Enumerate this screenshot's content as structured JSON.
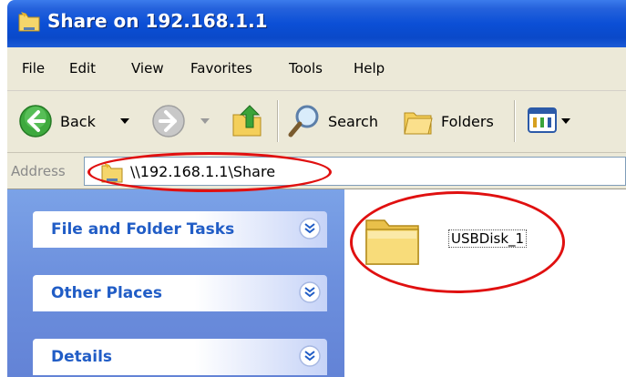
{
  "window": {
    "title": "Share on 192.168.1.1"
  },
  "menu": {
    "items": [
      {
        "label": "File"
      },
      {
        "label": "Edit"
      },
      {
        "label": "View"
      },
      {
        "label": "Favorites"
      },
      {
        "label": "Tools"
      },
      {
        "label": "Help"
      }
    ]
  },
  "toolbar": {
    "back_label": "Back",
    "search_label": "Search",
    "folders_label": "Folders"
  },
  "address": {
    "label": "Address",
    "value": "\\\\192.168.1.1\\Share"
  },
  "taskpane": {
    "panels": [
      {
        "title": "File and Folder Tasks"
      },
      {
        "title": "Other Places"
      },
      {
        "title": "Details"
      }
    ]
  },
  "content": {
    "items": [
      {
        "name": "USBDisk_1",
        "icon": "folder-icon"
      }
    ]
  },
  "colors": {
    "titlebar": "#0a49c9",
    "highlight_oval": "#e01010",
    "panel_title": "#215dc6",
    "taskpane_bg": "#6c8fdd"
  }
}
